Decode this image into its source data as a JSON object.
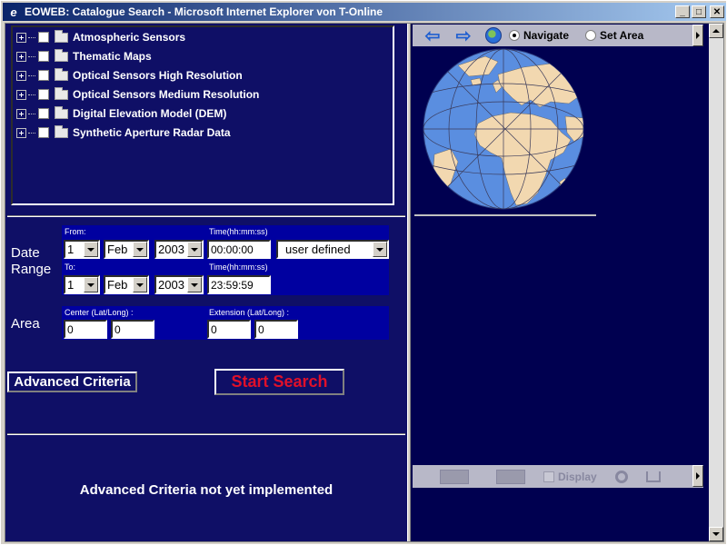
{
  "window": {
    "title": "EOWEB: Catalogue Search - Microsoft Internet Explorer von T-Online",
    "minimize": "_",
    "maximize": "□",
    "close": "✕"
  },
  "tree": {
    "items": [
      {
        "label": "Atmospheric Sensors"
      },
      {
        "label": "Thematic Maps"
      },
      {
        "label": "Optical Sensors High Resolution"
      },
      {
        "label": "Optical Sensors Medium Resolution"
      },
      {
        "label": "Digital Elevation Model (DEM)"
      },
      {
        "label": "Synthetic Aperture Radar Data"
      }
    ]
  },
  "date_range": {
    "label_line1": "Date",
    "label_line2": "Range",
    "from_label": "From:",
    "time_label": "Time(hh:mm:ss)",
    "from_day": "1",
    "from_month": "Feb",
    "from_year": "2003",
    "from_time": "00:00:00",
    "preset": "user defined",
    "to_label": "To:",
    "to_time_label": "Time(hh:mm:ss)",
    "to_day": "1",
    "to_month": "Feb",
    "to_year": "2003",
    "to_time": "23:59:59"
  },
  "area": {
    "label": "Area",
    "center_label": "Center (Lat/Long) :",
    "extension_label": "Extension (Lat/Long) :",
    "center_lat": "0",
    "center_long": "0",
    "ext_lat": "0",
    "ext_long": "0"
  },
  "buttons": {
    "advanced": "Advanced Criteria",
    "start": "Start Search"
  },
  "advanced_message": "Advanced Criteria not yet implemented",
  "map_toolbar": {
    "back_arrow": "⇦",
    "forward_arrow": "⇨",
    "navigate_label": "Navigate",
    "set_area_label": "Set Area",
    "mode": "Navigate"
  },
  "bottom_toolbar": {
    "display_label": "Display"
  },
  "colors": {
    "frame_bg": "#0f0f66",
    "panel_bg": "#0000a0",
    "start_text": "#e0102a",
    "ocean": "#5a8ee0",
    "land": "#f2d8b0"
  }
}
